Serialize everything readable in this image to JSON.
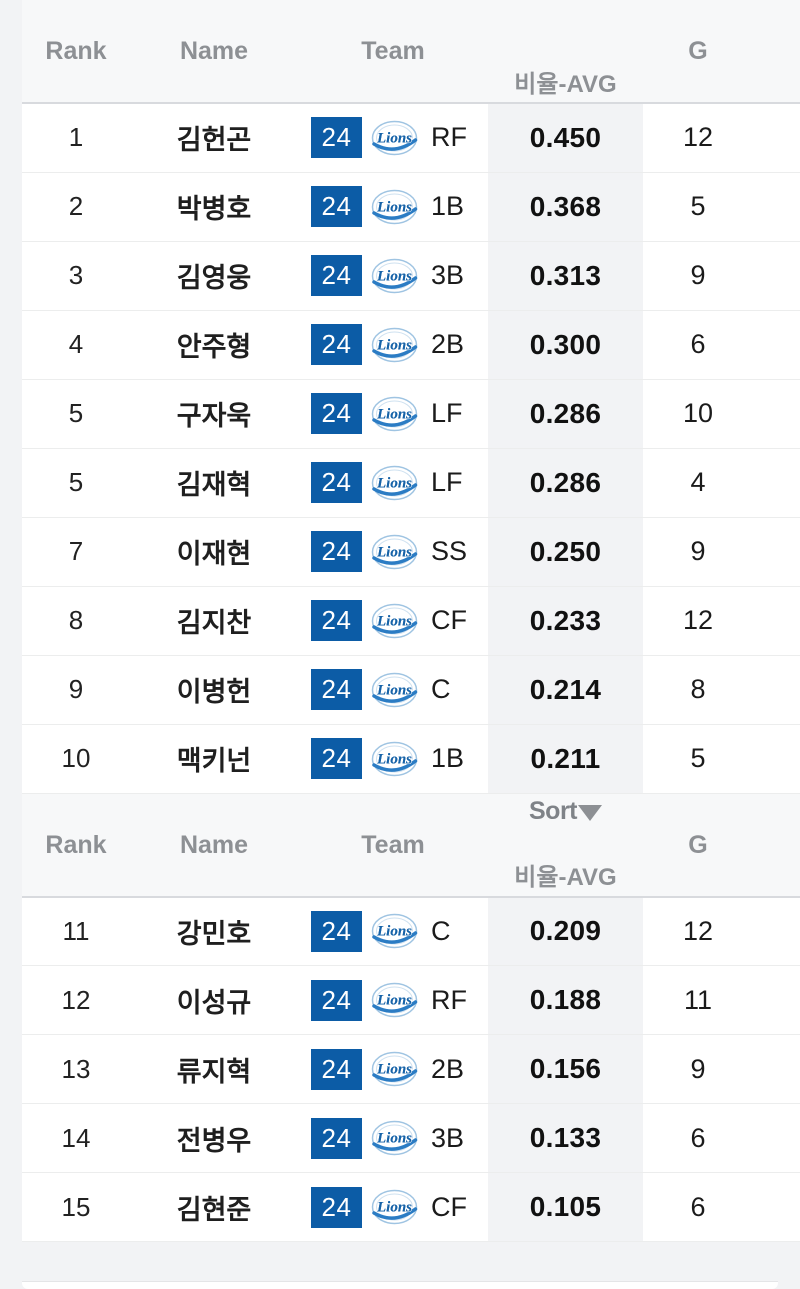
{
  "table": {
    "columns": {
      "rank": "Rank",
      "name": "Name",
      "team": "Team",
      "avg_sub": "비율-AVG",
      "g": "G",
      "sort": "Sort"
    },
    "sort_indicator": "▼",
    "team_badge_number": "24",
    "team_logo_name": "Lions",
    "sections": [
      {
        "header_has_sort": false,
        "rows": [
          {
            "rank": "1",
            "name": "김헌곤",
            "number": "24",
            "pos": "RF",
            "avg": "0.450",
            "g": "12"
          },
          {
            "rank": "2",
            "name": "박병호",
            "number": "24",
            "pos": "1B",
            "avg": "0.368",
            "g": "5"
          },
          {
            "rank": "3",
            "name": "김영웅",
            "number": "24",
            "pos": "3B",
            "avg": "0.313",
            "g": "9"
          },
          {
            "rank": "4",
            "name": "안주형",
            "number": "24",
            "pos": "2B",
            "avg": "0.300",
            "g": "6"
          },
          {
            "rank": "5",
            "name": "구자욱",
            "number": "24",
            "pos": "LF",
            "avg": "0.286",
            "g": "10"
          },
          {
            "rank": "5",
            "name": "김재혁",
            "number": "24",
            "pos": "LF",
            "avg": "0.286",
            "g": "4"
          },
          {
            "rank": "7",
            "name": "이재현",
            "number": "24",
            "pos": "SS",
            "avg": "0.250",
            "g": "9"
          },
          {
            "rank": "8",
            "name": "김지찬",
            "number": "24",
            "pos": "CF",
            "avg": "0.233",
            "g": "12"
          },
          {
            "rank": "9",
            "name": "이병헌",
            "number": "24",
            "pos": "C",
            "avg": "0.214",
            "g": "8"
          },
          {
            "rank": "10",
            "name": "맥키넌",
            "number": "24",
            "pos": "1B",
            "avg": "0.211",
            "g": "5"
          }
        ]
      },
      {
        "header_has_sort": true,
        "rows": [
          {
            "rank": "11",
            "name": "강민호",
            "number": "24",
            "pos": "C",
            "avg": "0.209",
            "g": "12"
          },
          {
            "rank": "12",
            "name": "이성규",
            "number": "24",
            "pos": "RF",
            "avg": "0.188",
            "g": "11"
          },
          {
            "rank": "13",
            "name": "류지혁",
            "number": "24",
            "pos": "2B",
            "avg": "0.156",
            "g": "9"
          },
          {
            "rank": "14",
            "name": "전병우",
            "number": "24",
            "pos": "3B",
            "avg": "0.133",
            "g": "6"
          },
          {
            "rank": "15",
            "name": "김현준",
            "number": "24",
            "pos": "CF",
            "avg": "0.105",
            "g": "6"
          }
        ]
      }
    ]
  },
  "colors": {
    "badge_blue": "#0c5ca6",
    "logo_blue": "#2b7cc4",
    "header_text": "#8d9094",
    "avg_column_bg": "#f2f3f5",
    "page_bg": "#f2f3f5"
  }
}
